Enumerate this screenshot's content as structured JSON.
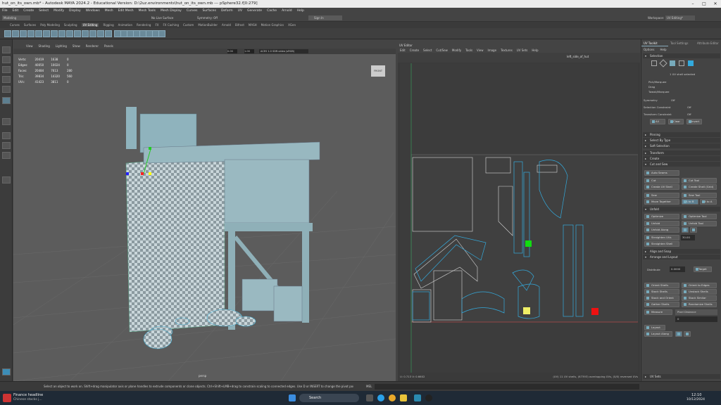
{
  "window": {
    "title": "hut_on_its_own.mb* - Autodesk MAYA 2024.2 - Educational Version: D:\\2uz.environments\\hut_on_its_own.mb   ---   pSphere32.f[0:279]"
  },
  "menu": [
    "File",
    "Edit",
    "Create",
    "Select",
    "Modify",
    "Display",
    "Windows",
    "Mesh",
    "Edit Mesh",
    "Mesh Tools",
    "Mesh Display",
    "Curves",
    "Surfaces",
    "Deform",
    "UV",
    "Generate",
    "Cache",
    "Arnold",
    "Help"
  ],
  "status": {
    "mode": "Modeling",
    "live": "No Live Surface",
    "symmetry": "Symmetry: Off",
    "signin": "Sign In",
    "workspace_label": "Workspace:",
    "workspace": "UV Editing*"
  },
  "shelf_tabs": [
    "Curves",
    "Surfaces",
    "Poly Modeling",
    "Sculpting",
    "UV Editing",
    "Rigging",
    "Animation",
    "Rendering",
    "FX",
    "FX Caching",
    "Custom",
    "MotionBuilder",
    "Arnold",
    "Bifrost",
    "MASH",
    "Motion Graphics",
    "XGen"
  ],
  "shelf_active": "UV Editing",
  "viewport": {
    "menu": [
      "View",
      "Shading",
      "Lighting",
      "Show",
      "Renderer",
      "Panels"
    ],
    "value1": "0.00",
    "value2": "1.00",
    "colorspace": "ACES 1.0 SDR-video (sRGB)",
    "hud": [
      [
        "Verts:",
        "20419",
        "1638",
        "0"
      ],
      [
        "Edges:",
        "40050",
        "10024",
        "0"
      ],
      [
        "Faces:",
        "20484",
        "7613",
        "280"
      ],
      [
        "Tris:",
        "39834",
        "14320",
        "560"
      ],
      [
        "UVs:",
        "41423",
        "3811",
        "0"
      ]
    ],
    "camera": "persp",
    "front_label": "FRONT"
  },
  "uv_editor": {
    "title": "UV Editor",
    "menu": [
      "Edit",
      "Create",
      "Select",
      "Cut/Sew",
      "Modify",
      "Tools",
      "View",
      "Image",
      "Textures",
      "UV Sets",
      "Help"
    ],
    "texture": "left_side_of_hut",
    "coords": "U: 0.713   V: 0.6602",
    "footer": "(UV) 11 UV shells, (67393) overlapping UVs, (0/0) reversed UVs"
  },
  "toolkit": {
    "tabs": [
      "UV Toolkit",
      "Tool Settings",
      "Attribute Editor"
    ],
    "subtabs": [
      "Options",
      "Help"
    ],
    "selection": "Selection",
    "shell_selected": "1 UV shell selected",
    "pickmarquee": "Pick/Marquee",
    "drag": "Drag",
    "tweak": "Tweak/Marquee",
    "symmetry": "Symmetry",
    "symmetry_val": "Off",
    "sel_constraint": "Selection Constraint",
    "sel_constraint_val": "Off",
    "transform_constraint": "Transform Constraint",
    "transform_constraint_val": "Off",
    "all": "All",
    "clear": "Clear",
    "invert": "Invert",
    "sections": [
      "Pinning",
      "Select By Type",
      "Soft Selection",
      "Transform",
      "Create",
      "Cut and Sew"
    ],
    "auto_seams": "Auto Seams",
    "cut": "Cut",
    "cut_tool": "Cut Tool",
    "create_shell": "Create UV Shell",
    "create_shell_grid": "Create Shell (Grid)",
    "sew": "Sew",
    "sew_tool": "Sew Tool",
    "move_sew": "Move Together",
    "ab": "A to B",
    "ba": "B to A",
    "unfold": "Unfold",
    "optimize": "Optimize",
    "optimize_tool": "Optimize Tool",
    "unfold_btn": "Unfold",
    "unfold_tool": "Unfold Tool",
    "unfold_along": "Unfold Along",
    "u": "U",
    "v": "V",
    "straighten_uvs": "Straighten UVs",
    "straighten_val": "30.00",
    "straighten_shell": "Straighten Shell",
    "align_snap": "Align and Snap",
    "arrange": "Arrange and Layout",
    "distribute": "Distribute",
    "distribute_val": "0.0000",
    "target": "Target",
    "orient_shells": "Orient Shells",
    "orient_edges": "Orient to Edges",
    "stack_shells": "Stack Shells",
    "unstack_shells": "Unstack Shells",
    "stack_orient": "Stack and Orient",
    "stack_similar": "Stack Similar",
    "gather_shells": "Gather Shells",
    "randomize_shells": "Randomize Shells",
    "measure": "Measure",
    "pixel_distance": "Pixel Distance",
    "measure_val": "0",
    "layout": "Layout",
    "layout_along": "Layout Along",
    "uvsets": "UV Sets"
  },
  "cmd": {
    "help": "Select an object to work on. Shift+drag manipulator axis or plane handles to extrude components or clone objects. Ctrl+Shift+LMB+drag to constrain scaling to connected edges. Use D or INSERT to change the pivot position and axis orientation.",
    "mel": "MEL"
  },
  "taskbar": {
    "news_title": "Finance headline",
    "news_sub": "Chinese stocks j...",
    "search": "Search",
    "time": "12:10",
    "date": "10/12/2024"
  }
}
